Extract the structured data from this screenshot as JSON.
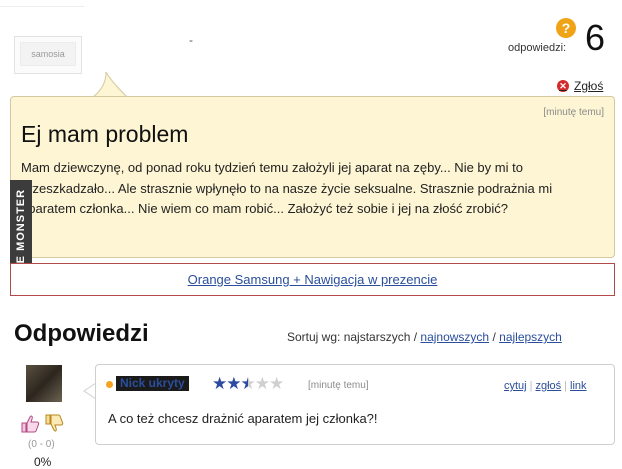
{
  "top": {
    "avatar_text": "samosia",
    "dash": "-"
  },
  "answers_counter": {
    "icon": "question-icon",
    "icon_glyph": "?",
    "label": "odpowiedzi:",
    "count": "6"
  },
  "report": {
    "icon": "close-icon",
    "label": "Zgłoś"
  },
  "question": {
    "time": "[minutę temu]",
    "title": "Ej mam problem",
    "body": "Mam dziewczynę, od ponad roku tydzień temu założyli jej aparat na zęby... Nie by mi to przeszkadzało... Ale strasznie wpłynęło to na nasze życie seksualne. Strasznie podrażnia mi aparatem członka... Nie wiem co mam robić... Założyć też sobie i jej na złość zrobić?"
  },
  "watermark": "JOE MONSTER",
  "ad": {
    "link": "Orange Samsung + Nawigacja w prezencie"
  },
  "answers_section": {
    "title": "Odpowiedzi",
    "sort_label": "Sortuj wg: najstarszych /",
    "sort_newest": "najnowszych",
    "sort_sep": "/",
    "sort_best": "najlepszych"
  },
  "answer": {
    "author": "Nick ukryty",
    "rating": 2.5,
    "rating_max": 5,
    "time": "[minutę temu]",
    "actions": {
      "quote": "cytuj",
      "report": "zgłoś",
      "link": "link"
    },
    "text": "A co też chcesz drażnić aparatem jej członka?!",
    "votes": "(0 - 0)",
    "percent": "0%"
  },
  "colors": {
    "question_bg": "#fdf5d3",
    "link": "#2a4e9c",
    "ad_border": "#b24a4a",
    "accent_orange": "#f0a316",
    "report_red": "#d42a2a",
    "star_filled": "#2c4aa0",
    "star_empty": "#d0d0d0"
  }
}
